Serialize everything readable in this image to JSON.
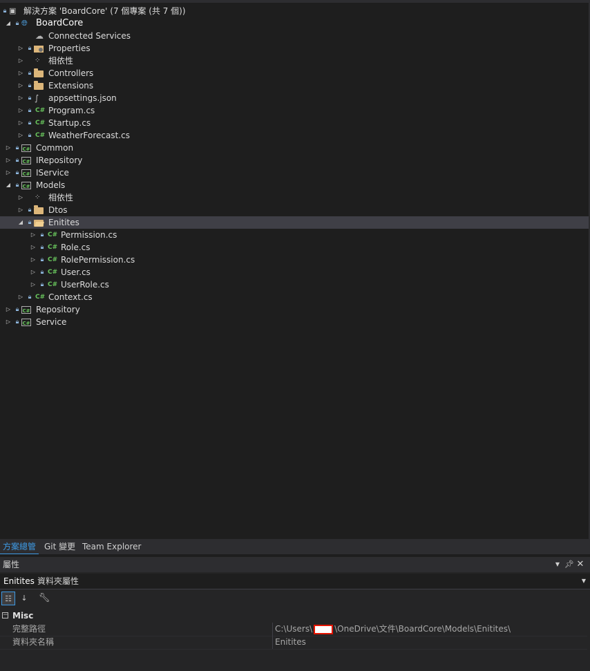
{
  "solution": {
    "label": "解決方案 'BoardCore' (7 個專案 (共 7 個))"
  },
  "tree": [
    {
      "label": "BoardCore",
      "icon": "web-project-icon",
      "expanded": true
    },
    {
      "label": "Connected Services",
      "icon": "connected-services-icon"
    },
    {
      "label": "Properties",
      "icon": "properties-folder-icon"
    },
    {
      "label": "相依性",
      "icon": "dependencies-icon"
    },
    {
      "label": "Controllers",
      "icon": "folder-icon"
    },
    {
      "label": "Extensions",
      "icon": "folder-icon"
    },
    {
      "label": "appsettings.json",
      "icon": "json-file-icon"
    },
    {
      "label": "Program.cs",
      "icon": "csharp-file-icon"
    },
    {
      "label": "Startup.cs",
      "icon": "csharp-file-icon"
    },
    {
      "label": "WeatherForecast.cs",
      "icon": "csharp-file-icon"
    },
    {
      "label": "Common",
      "icon": "csharp-project-icon"
    },
    {
      "label": "IRepository",
      "icon": "csharp-project-icon"
    },
    {
      "label": "IService",
      "icon": "csharp-project-icon"
    },
    {
      "label": "Models",
      "icon": "csharp-project-icon",
      "expanded": true
    },
    {
      "label": "相依性",
      "icon": "dependencies-icon"
    },
    {
      "label": "Dtos",
      "icon": "folder-icon"
    },
    {
      "label": "Enitites",
      "icon": "folder-open-icon",
      "expanded": true,
      "selected": true
    },
    {
      "label": "Permission.cs",
      "icon": "csharp-file-icon"
    },
    {
      "label": "Role.cs",
      "icon": "csharp-file-icon"
    },
    {
      "label": "RolePermission.cs",
      "icon": "csharp-file-icon"
    },
    {
      "label": "User.cs",
      "icon": "csharp-file-icon"
    },
    {
      "label": "UserRole.cs",
      "icon": "csharp-file-icon"
    },
    {
      "label": "Context.cs",
      "icon": "csharp-file-icon"
    },
    {
      "label": "Repository",
      "icon": "csharp-project-icon"
    },
    {
      "label": "Service",
      "icon": "csharp-project-icon"
    }
  ],
  "icons": {
    "csharp_file": "C#",
    "csharp_project": "C#"
  },
  "tabs": [
    {
      "label": "方案總管",
      "active": true
    },
    {
      "label": "Git 變更"
    },
    {
      "label": "Team Explorer"
    }
  ],
  "properties": {
    "title": "屬性",
    "object_name": "Enitites",
    "object_type": "資料夾屬性",
    "category": "Misc",
    "rows": [
      {
        "name": "完整路徑",
        "value_prefix": "C:\\Users\\",
        "value_suffix": "\\OneDrive\\文件\\BoardCore\\Models\\Enitites\\"
      },
      {
        "name": "資料夾名稱",
        "value": "Enitites"
      }
    ]
  },
  "colors": {
    "background": "#1e1e1e",
    "selection": "#3f3f46",
    "accent": "#3e9be6",
    "csharp_green": "#68c35c",
    "folder": "#dcb67a",
    "redaction": "#e51400"
  }
}
